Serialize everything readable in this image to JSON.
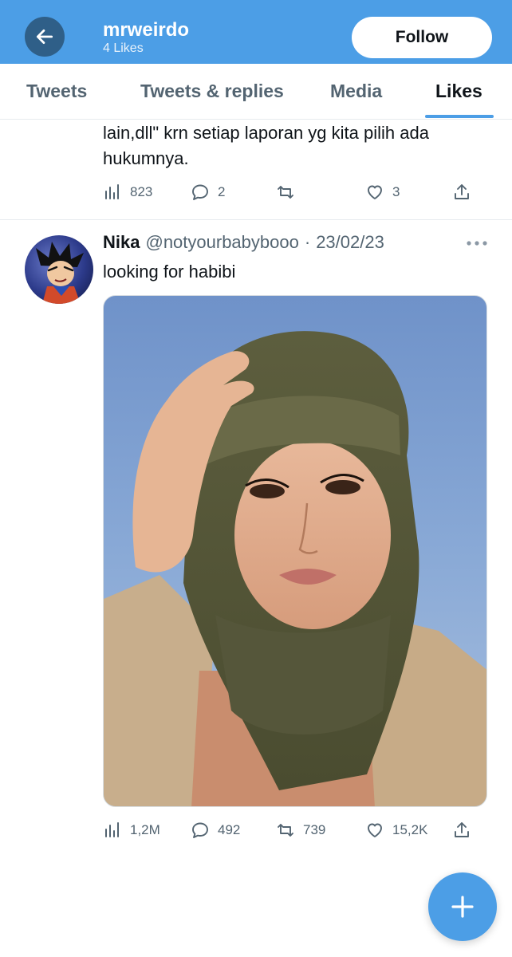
{
  "header": {
    "name": "mrweirdo",
    "subtitle": "4 Likes",
    "follow_label": "Follow"
  },
  "tabs": [
    {
      "label": "Tweets",
      "active": false
    },
    {
      "label": "Tweets & replies",
      "active": false
    },
    {
      "label": "Media",
      "active": false
    },
    {
      "label": "Likes",
      "active": true
    }
  ],
  "previous_tweet": {
    "text_line1": "lain,dll\" krn setiap laporan yg kita pilih ada",
    "text_line2": "hukumnya.",
    "views": "823",
    "replies": "2",
    "retweets": "",
    "likes": "3"
  },
  "tweet": {
    "name": "Nika",
    "handle": "@notyourbabybooo",
    "separator": "·",
    "date": "23/02/23",
    "text": "looking for habibi",
    "views": "1,2M",
    "replies": "492",
    "retweets": "739",
    "likes": "15,2K"
  },
  "icons": {
    "back": "arrow-left-icon",
    "views": "bar-chart-icon",
    "reply": "speech-bubble-icon",
    "retweet": "retweet-icon",
    "like": "heart-icon",
    "share": "share-icon",
    "more": "more-dots-icon",
    "compose": "plus-icon"
  },
  "colors": {
    "accent": "#4c9ee6",
    "text_primary": "#0f1419",
    "text_secondary": "#536471"
  }
}
